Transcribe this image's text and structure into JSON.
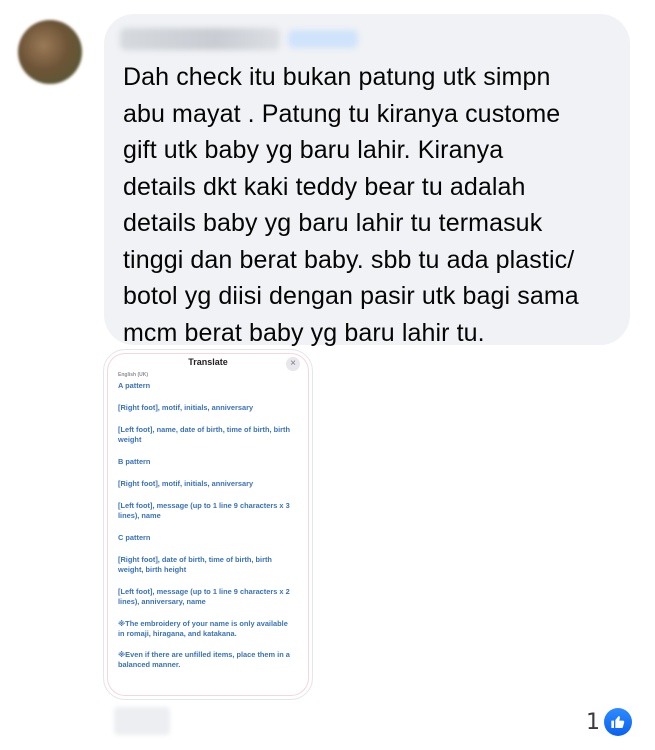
{
  "comment": {
    "author_name": "",
    "author_badge": "",
    "text": "Dah check itu bukan patung utk simpn abu mayat . Patung tu kiranya custome gift utk baby yg baru lahir. Kiranya details dkt kaki teddy bear tu adalah details baby yg baru lahir tu termasuk tinggi dan berat baby. sbb tu ada plastic/ botol yg diisi dengan pasir utk bagi sama mcm berat baby yg baru lahir tu.",
    "lines": [
      "Dah check itu bukan patung utk simpn",
      "abu mayat . Patung tu kiranya custome",
      "gift utk baby yg baru lahir. Kiranya",
      "details dkt kaki teddy bear tu adalah",
      "details baby yg baru lahir tu termasuk",
      "tinggi dan berat baby. sbb tu ada plastic/",
      "botol yg diisi dengan pasir utk bagi sama",
      "mcm berat baby yg baru lahir tu."
    ]
  },
  "attachment": {
    "title": "Translate",
    "close_glyph": "×",
    "language": "English (UK)",
    "items": [
      "A pattern",
      "[Right foot], motif, initials, anniversary",
      "[Left foot], name, date of birth, time of birth, birth weight",
      "B pattern",
      "[Right foot], motif, initials, anniversary",
      "[Left foot], message (up to 1 line 9 characters x 3 lines), name",
      "C pattern",
      "[Right foot], date of birth, time of birth, birth weight, birth height",
      "[Left foot], message (up to 1 line 9 characters x 2 lines), anniversary, name",
      "※The embroidery of your name is only available in romaji, hiragana, and katakana.",
      "※Even if there are unfilled items, place them in a balanced manner."
    ]
  },
  "reactions": {
    "count": "1",
    "icon": "like-icon",
    "color": "#1877f2"
  }
}
